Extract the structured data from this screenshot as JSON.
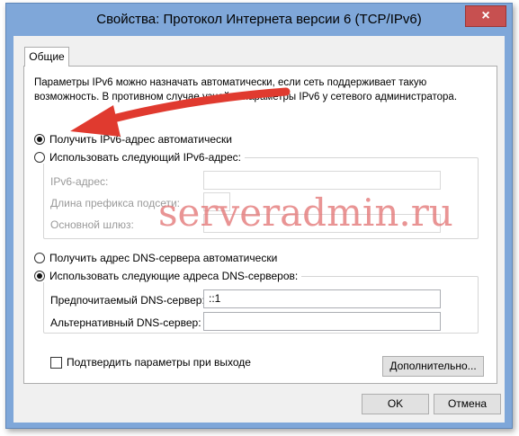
{
  "window": {
    "title": "Свойства: Протокол Интернета версии 6 (TCP/IPv6)",
    "close_label": "×"
  },
  "tabs": [
    {
      "label": "Общие",
      "selected": true
    }
  ],
  "general": {
    "description": "Параметры IPv6 можно назначать автоматически, если сеть поддерживает такую возможность. В противном случае узнайте параметры IPv6 у сетевого администратора.",
    "ip_auto_label": "Получить IPv6-адрес автоматически",
    "ip_manual_label": "Использовать следующий IPv6-адрес:",
    "ip_auto_selected": true,
    "ipv6_address_label": "IPv6-адрес:",
    "ipv6_address_value": "",
    "prefix_length_label": "Длина префикса подсети:",
    "prefix_length_value": "",
    "gateway_label": "Основной шлюз:",
    "gateway_value": "",
    "dns_auto_label": "Получить адрес DNS-сервера автоматически",
    "dns_manual_label": "Использовать следующие адреса DNS-серверов:",
    "dns_manual_selected": true,
    "preferred_dns_label": "Предпочитаемый DNS-сервер:",
    "preferred_dns_value": "::1",
    "alternate_dns_label": "Альтернативный DNS-сервер:",
    "alternate_dns_value": "",
    "validate_label": "Подтвердить параметры при выходе",
    "validate_checked": false,
    "advanced_button": "Дополнительно..."
  },
  "footer": {
    "ok_label": "OK",
    "cancel_label": "Отмена"
  },
  "watermark": "serveradmin.ru",
  "colors": {
    "titlebar": "#7fa7d9",
    "close_button": "#c75050",
    "annotation_arrow": "#e03a2f",
    "watermark": "#e27070"
  }
}
